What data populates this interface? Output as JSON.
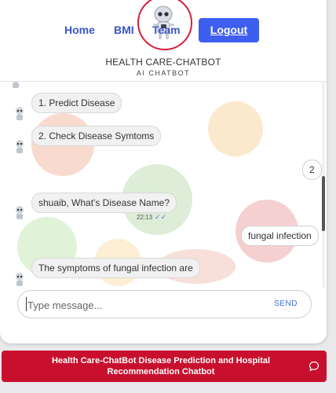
{
  "nav": {
    "home": "Home",
    "bmi": "BMI",
    "team": "Team",
    "logout": "Logout"
  },
  "brand": {
    "title": "HEALTH CARE-CHATBOT",
    "subtitle": "AI CHATBOT"
  },
  "chat": {
    "messages": [
      {
        "from": "bot",
        "text": "1. Predict Disease"
      },
      {
        "from": "bot",
        "text": "2. Check Disease Symtoms"
      },
      {
        "from": "user",
        "text": "2"
      },
      {
        "from": "bot",
        "text": "shuaib, What's Disease Name?",
        "time": "22:13",
        "status": "✓✓"
      },
      {
        "from": "user",
        "text": "fungal infection"
      },
      {
        "from": "bot",
        "text": "The symptoms of fungal infection are"
      }
    ]
  },
  "composer": {
    "placeholder": "Type message...",
    "send_label": "SEND"
  },
  "footer": {
    "text": "Health Care-ChatBot Disease Prediction and Hospital Recommendation Chatbot",
    "icon": "chat-bubble-icon"
  },
  "colors": {
    "nav_link": "#3b56c6",
    "logout_bg": "#3e5ef0",
    "logo_ring": "#d21f3c",
    "footer_bg": "#c8102e",
    "send": "#3b6fd8"
  }
}
